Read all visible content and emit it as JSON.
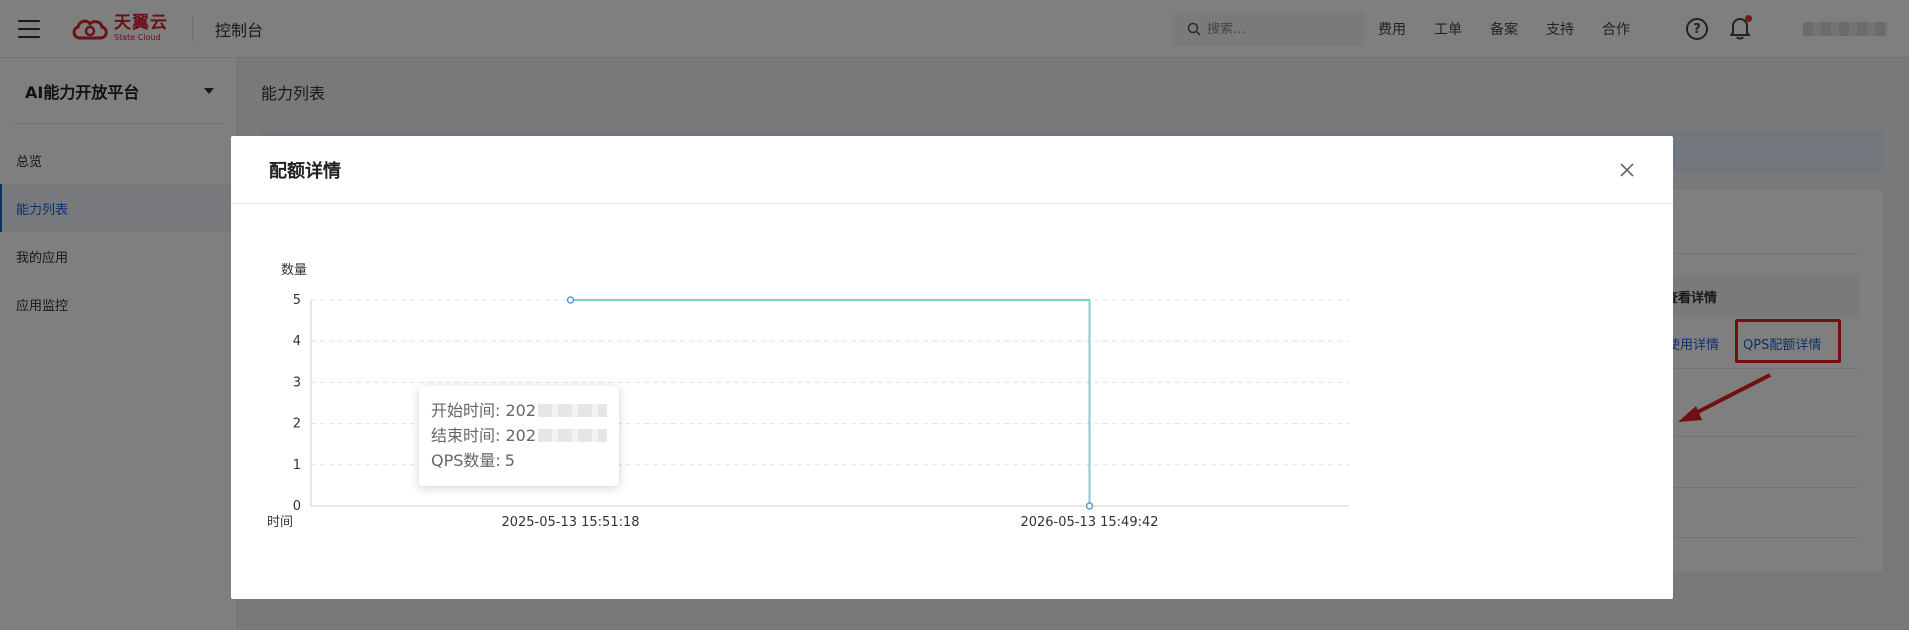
{
  "topbar": {
    "logo_cn": "天翼云",
    "logo_en": "State Cloud",
    "console_title": "控制台",
    "search_placeholder": "搜索...",
    "nav_links": [
      "费用",
      "工单",
      "备案",
      "支持",
      "合作"
    ]
  },
  "sidebar": {
    "platform_title": "AI能力开放平台",
    "items": [
      {
        "label": "总览"
      },
      {
        "label": "能力列表"
      },
      {
        "label": "我的应用"
      },
      {
        "label": "应用监控"
      }
    ]
  },
  "main": {
    "page_title": "能力列表",
    "table_header": "查看详情",
    "link_usage": "使用详情",
    "link_qps": "QPS配额详情"
  },
  "modal": {
    "title": "配额详情",
    "tooltip": {
      "start_label": "开始时间: 202",
      "end_label": "结束时间: 202",
      "qps_label": "QPS数量:",
      "qps_value": "5"
    }
  },
  "chart_data": {
    "type": "line",
    "step": true,
    "ylabel": "数量",
    "xlabel": "时间",
    "ylim": [
      0,
      5
    ],
    "yticks": [
      0,
      1,
      2,
      3,
      4,
      5
    ],
    "xticks": [
      "2025-05-13 15:51:18",
      "2026-05-13 15:49:42"
    ],
    "series": [
      {
        "x": [
          "2025-05-13 15:51:18",
          "2026-05-13 15:49:42",
          "2026-05-13 15:49:42"
        ],
        "y": [
          5,
          5,
          0
        ]
      }
    ],
    "grid": true,
    "colors": {
      "line": "#7fd0c8",
      "point": "#5b9bd5"
    }
  }
}
